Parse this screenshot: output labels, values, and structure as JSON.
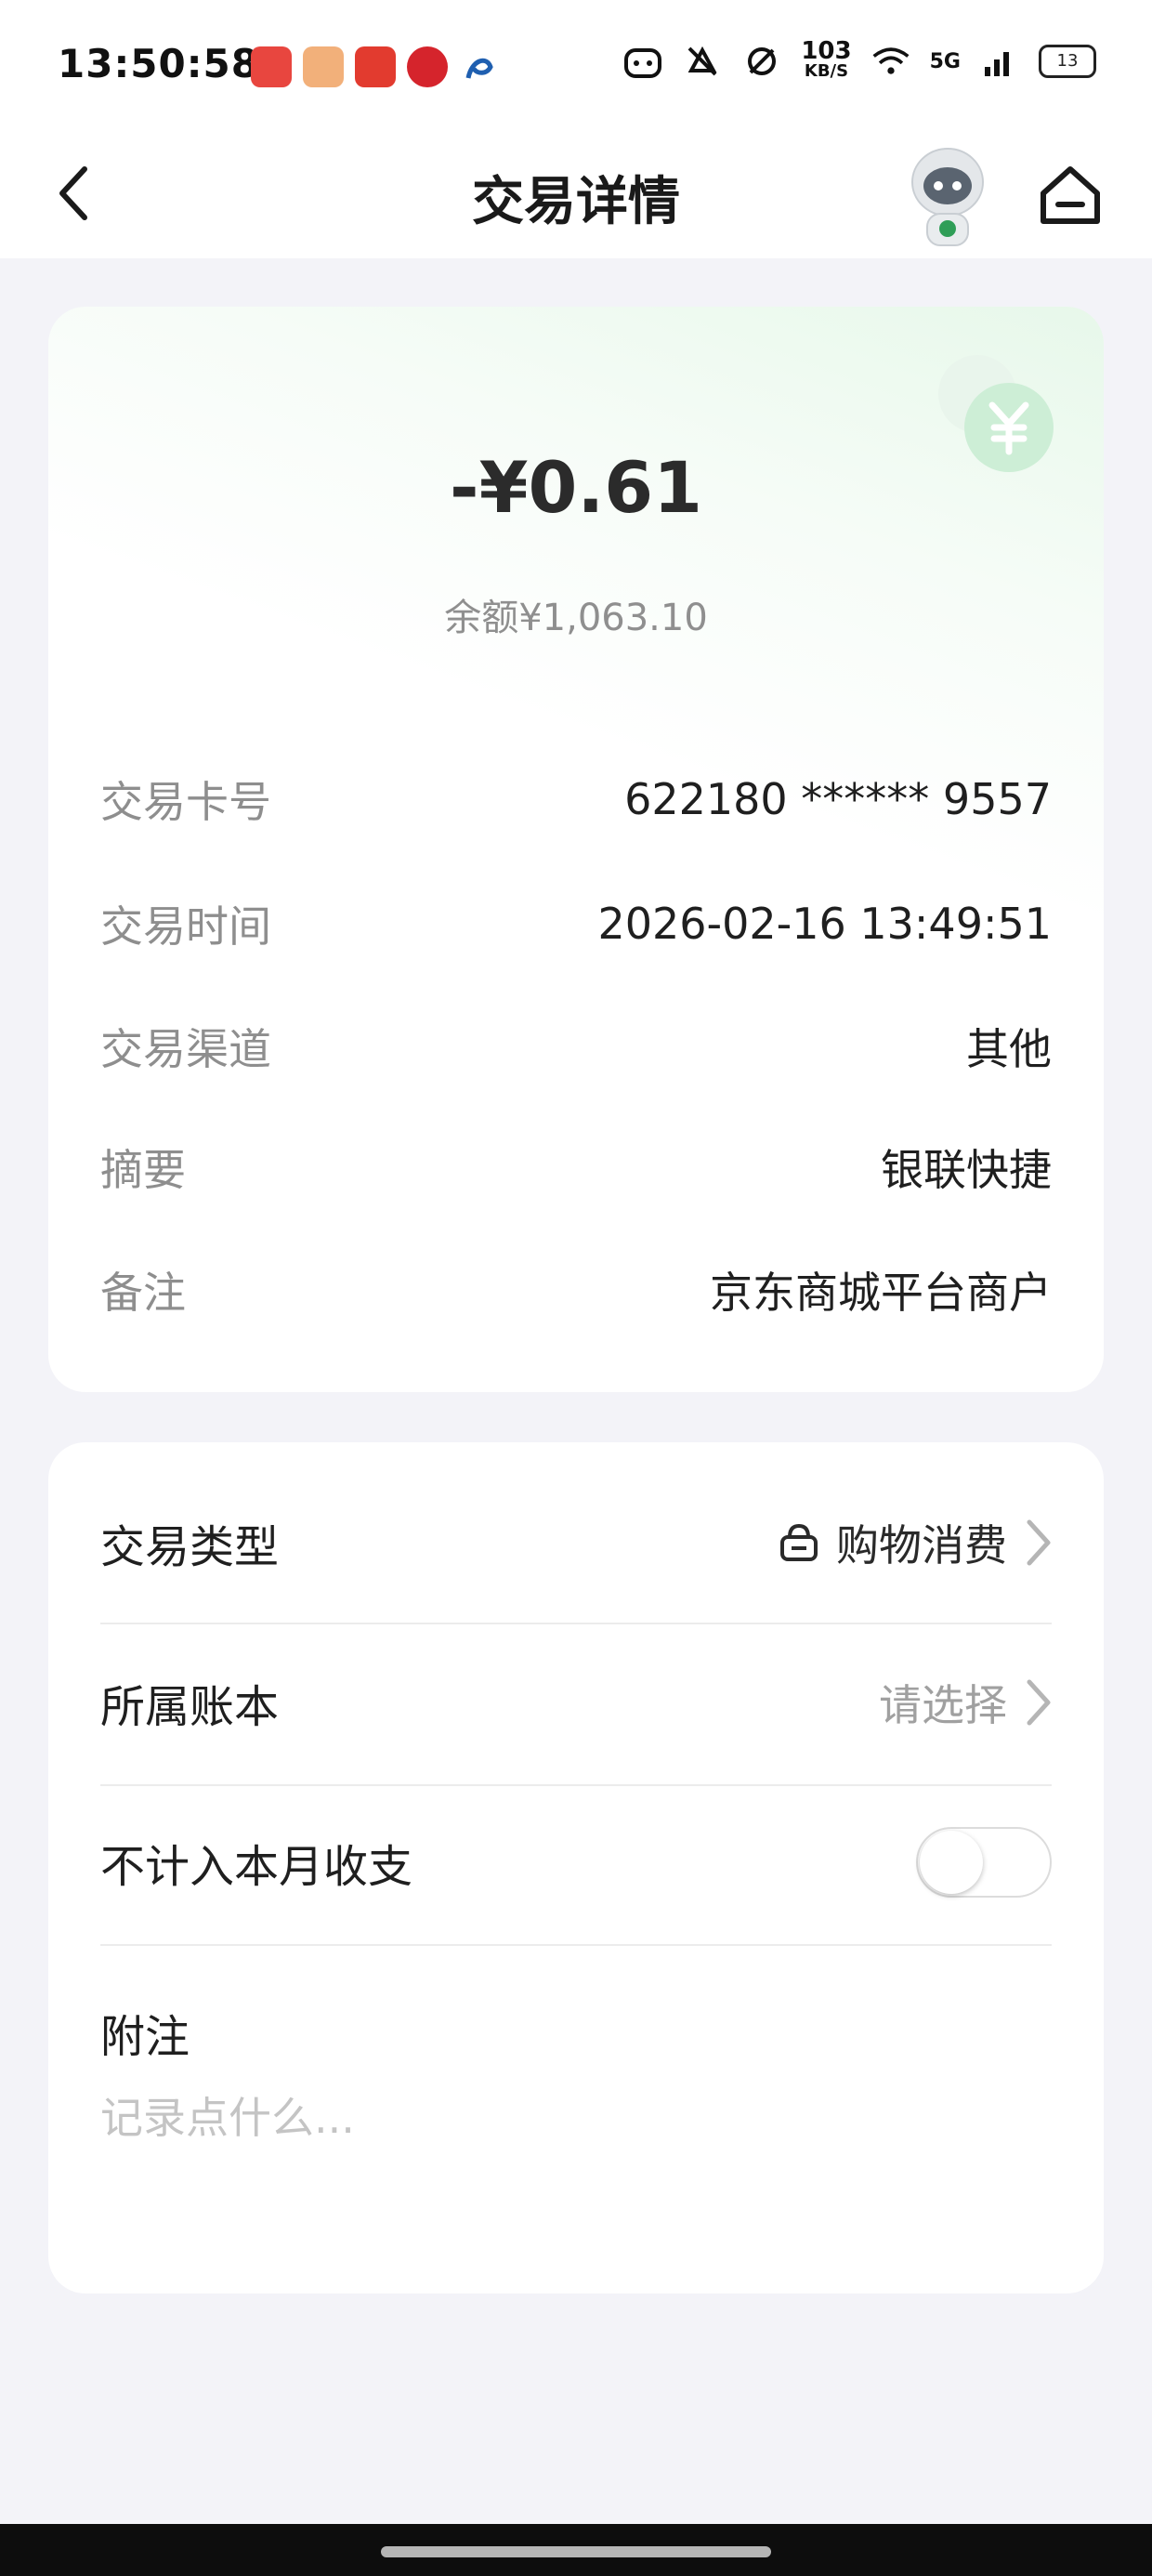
{
  "status_bar": {
    "time": "13:50:58",
    "net_speed_value": "103",
    "net_speed_unit": "KB/S",
    "network": "5G",
    "battery": "13"
  },
  "nav": {
    "title": "交易详情",
    "back_icon": "chevron-left-icon",
    "home_icon": "home-icon"
  },
  "summary": {
    "amount": "-¥0.61",
    "balance": "余额¥1,063.10"
  },
  "details": [
    {
      "label": "交易卡号",
      "value": "622180 ****** 9557"
    },
    {
      "label": "交易时间",
      "value": "2026-02-16 13:49:51"
    },
    {
      "label": "交易渠道",
      "value": "其他"
    },
    {
      "label": "摘要",
      "value": "银联快捷"
    },
    {
      "label": "备注",
      "value": "京东商城平台商户"
    }
  ],
  "settings": {
    "type_label": "交易类型",
    "type_value": "购物消费",
    "ledger_label": "所属账本",
    "ledger_value": "请选择",
    "exclude_label": "不计入本月收支",
    "exclude_enabled": false,
    "memo_label": "附注",
    "memo_placeholder": "记录点什么..."
  },
  "colors": {
    "accent_green": "#5cc67a",
    "background": "#f3f3f8"
  }
}
